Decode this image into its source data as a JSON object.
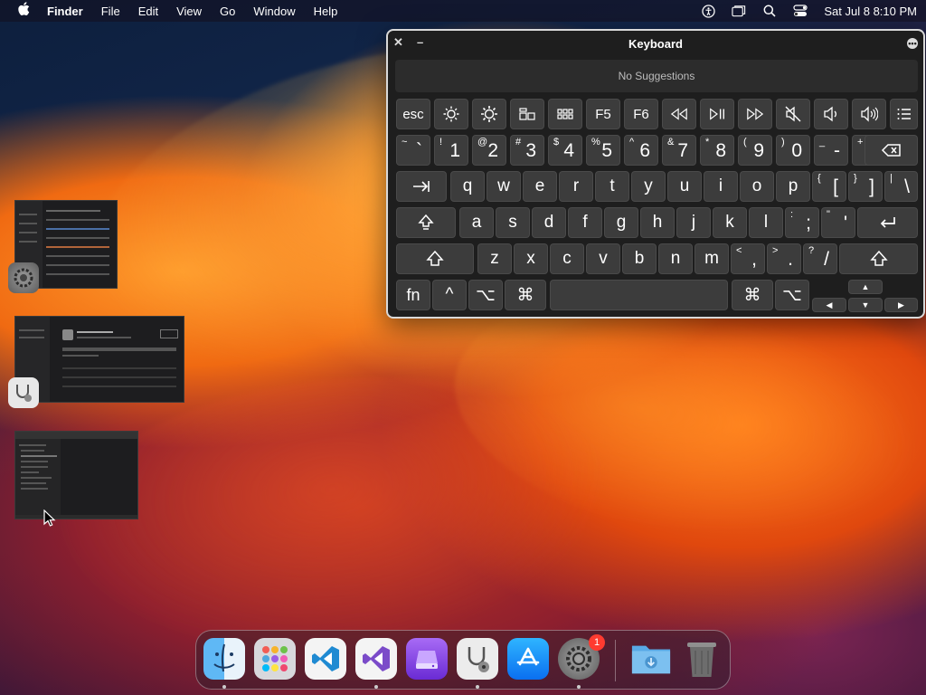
{
  "menubar": {
    "apple_icon": "apple-logo-icon",
    "app_name": "Finder",
    "menus": [
      "File",
      "Edit",
      "View",
      "Go",
      "Window",
      "Help"
    ],
    "status_icons": [
      "accessibility-icon",
      "window-icon",
      "search-icon",
      "control-center-icon"
    ],
    "clock": "Sat Jul 8  8:10 PM"
  },
  "keyboard_viewer": {
    "title": "Keyboard",
    "suggestions": "No Suggestions",
    "function_row": [
      "esc",
      "F5",
      "F6"
    ],
    "number_row": [
      {
        "top": "~",
        "main": "`"
      },
      {
        "top": "!",
        "main": "1"
      },
      {
        "top": "@",
        "main": "2"
      },
      {
        "top": "#",
        "main": "3"
      },
      {
        "top": "$",
        "main": "4"
      },
      {
        "top": "%",
        "main": "5"
      },
      {
        "top": "^",
        "main": "6"
      },
      {
        "top": "&",
        "main": "7"
      },
      {
        "top": "*",
        "main": "8"
      },
      {
        "top": "(",
        "main": "9"
      },
      {
        "top": ")",
        "main": "0"
      },
      {
        "top": "_",
        "main": "-"
      },
      {
        "top": "+",
        "main": "="
      }
    ],
    "qwerty_row": [
      "q",
      "w",
      "e",
      "r",
      "t",
      "y",
      "u",
      "i",
      "o",
      "p"
    ],
    "qwerty_punct": [
      {
        "top": "{",
        "main": "["
      },
      {
        "top": "}",
        "main": "]"
      },
      {
        "top": "|",
        "main": "\\"
      }
    ],
    "home_row": [
      "a",
      "s",
      "d",
      "f",
      "g",
      "h",
      "j",
      "k",
      "l"
    ],
    "home_punct": [
      {
        "top": ":",
        "main": ";"
      },
      {
        "top": "\"",
        "main": "'"
      }
    ],
    "bottom_row": [
      "z",
      "x",
      "c",
      "v",
      "b",
      "n",
      "m"
    ],
    "bottom_punct": [
      {
        "top": "<",
        "main": ","
      },
      {
        "top": ">",
        "main": "."
      },
      {
        "top": "?",
        "main": "/"
      }
    ],
    "modifier_fn": "fn",
    "modifier_control": "^",
    "modifier_option": "⌥",
    "modifier_command": "⌘",
    "arrow_up": "▲",
    "arrow_down": "▼",
    "arrow_left": "◀",
    "arrow_right": "▶"
  },
  "dock": {
    "items": [
      "finder-icon",
      "launchpad-icon",
      "vscode-icon",
      "visual-studio-icon",
      "ssd-utility-icon",
      "disk-utility-icon",
      "app-store-icon",
      "system-settings-icon",
      "downloads-folder-icon",
      "trash-icon"
    ],
    "settings_badge": "1"
  }
}
